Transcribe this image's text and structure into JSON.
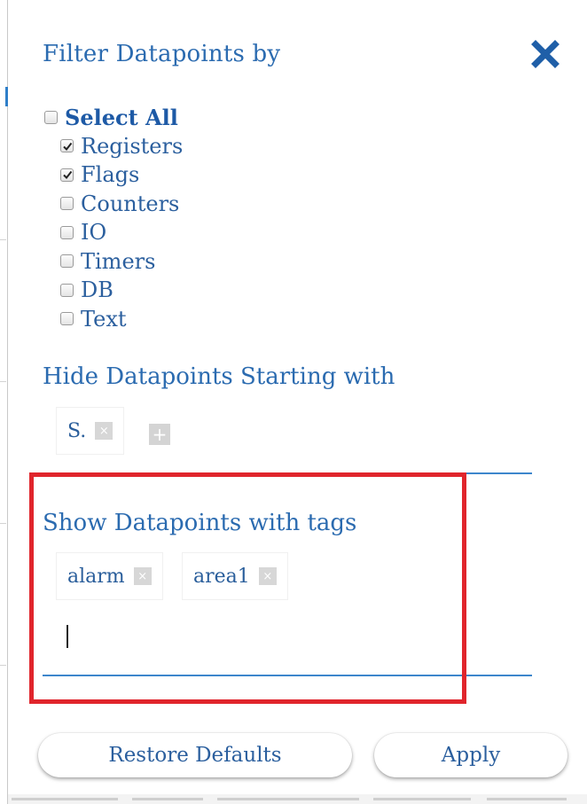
{
  "dialog": {
    "title": "Filter Datapoints by",
    "close_icon": "close-x-icon",
    "accent_color": "#2b6bb0",
    "highlight_color": "#e0252c"
  },
  "filter": {
    "select_all": {
      "label": "Select All",
      "checked": false
    },
    "types": [
      {
        "label": "Registers",
        "checked": true
      },
      {
        "label": "Flags",
        "checked": true
      },
      {
        "label": "Counters",
        "checked": false
      },
      {
        "label": "IO",
        "checked": false
      },
      {
        "label": "Timers",
        "checked": false
      },
      {
        "label": "DB",
        "checked": false
      },
      {
        "label": "Text",
        "checked": false
      }
    ]
  },
  "hide_section": {
    "title": "Hide Datapoints Starting with",
    "chips": [
      {
        "label": "S.",
        "remove": "×"
      }
    ],
    "add_label": "+"
  },
  "tags_section": {
    "title": "Show Datapoints with tags",
    "chips": [
      {
        "label": "alarm",
        "remove": "×"
      },
      {
        "label": "area1",
        "remove": "×"
      }
    ],
    "input_value": ""
  },
  "footer": {
    "restore_label": "Restore Defaults",
    "apply_label": "Apply"
  }
}
